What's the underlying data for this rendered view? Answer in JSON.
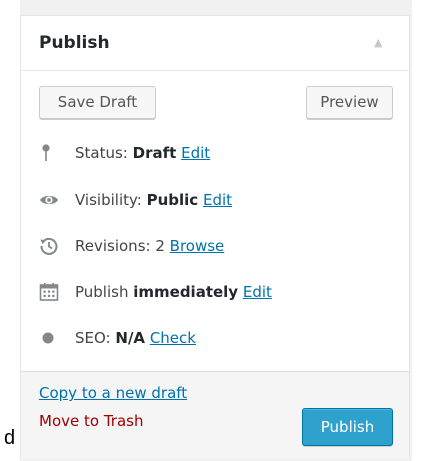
{
  "outside": {
    "stray_char": "d"
  },
  "panel": {
    "title": "Publish",
    "collapse_icon": "triangle-up-icon",
    "buttons": {
      "save_draft": "Save Draft",
      "preview": "Preview"
    },
    "rows": {
      "status": {
        "icon": "pin-icon",
        "label": "Status:",
        "value": "Draft",
        "link": "Edit"
      },
      "visibility": {
        "icon": "eye-icon",
        "label": "Visibility:",
        "value": "Public",
        "link": "Edit"
      },
      "revisions": {
        "icon": "history-icon",
        "label": "Revisions:",
        "value": "2",
        "link": "Browse"
      },
      "publish": {
        "icon": "calendar-icon",
        "label": "Publish",
        "value": "immediately",
        "link": "Edit"
      },
      "seo": {
        "icon": "dot-icon",
        "label": "SEO:",
        "value": "N/A",
        "link": "Check"
      }
    },
    "footer": {
      "copy_link": "Copy to a new draft",
      "trash_link": "Move to Trash",
      "publish_button": "Publish"
    }
  },
  "colors": {
    "link": "#0073aa",
    "trash": "#a00000",
    "primary_button": "#2ea2cc",
    "icon": "#82878c"
  }
}
